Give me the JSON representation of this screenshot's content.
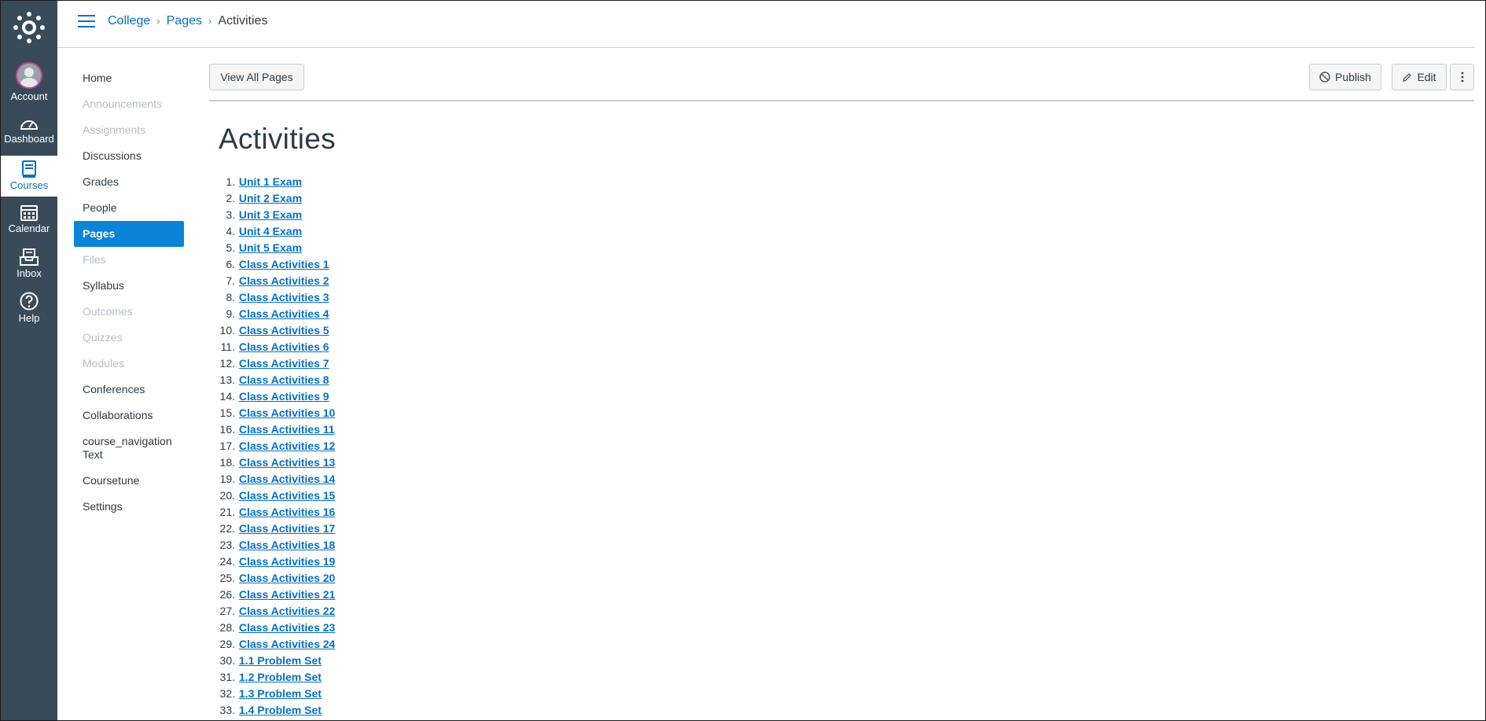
{
  "global_nav": {
    "account": "Account",
    "dashboard": "Dashboard",
    "courses": "Courses",
    "calendar": "Calendar",
    "inbox": "Inbox",
    "help": "Help"
  },
  "breadcrumb": {
    "course": "College",
    "section": "Pages",
    "current": "Activities"
  },
  "course_nav": [
    {
      "label": "Home",
      "state": "normal"
    },
    {
      "label": "Announcements",
      "state": "disabled"
    },
    {
      "label": "Assignments",
      "state": "disabled"
    },
    {
      "label": "Discussions",
      "state": "normal"
    },
    {
      "label": "Grades",
      "state": "normal"
    },
    {
      "label": "People",
      "state": "normal"
    },
    {
      "label": "Pages",
      "state": "active"
    },
    {
      "label": "Files",
      "state": "disabled"
    },
    {
      "label": "Syllabus",
      "state": "normal"
    },
    {
      "label": "Outcomes",
      "state": "disabled"
    },
    {
      "label": "Quizzes",
      "state": "disabled"
    },
    {
      "label": "Modules",
      "state": "disabled"
    },
    {
      "label": "Conferences",
      "state": "normal"
    },
    {
      "label": "Collaborations",
      "state": "normal"
    },
    {
      "label": "course_navigation Text",
      "state": "normal"
    },
    {
      "label": "Coursetune",
      "state": "normal"
    },
    {
      "label": "Settings",
      "state": "normal"
    }
  ],
  "toolbar": {
    "view_all": "View All Pages",
    "publish": "Publish",
    "edit": "Edit"
  },
  "page": {
    "title": "Activities",
    "links": [
      "Unit 1 Exam",
      "Unit 2 Exam",
      "Unit 3 Exam",
      "Unit 4 Exam",
      "Unit 5 Exam",
      "Class Activities 1",
      "Class Activities 2",
      "Class Activities 3",
      "Class Activities 4",
      "Class Activities 5",
      "Class Activities 6",
      "Class Activities 7",
      "Class Activities 8",
      "Class Activities 9",
      "Class Activities 10",
      "Class Activities 11",
      "Class Activities 12",
      "Class Activities 13",
      "Class Activities 14",
      "Class Activities 15",
      "Class Activities 16",
      "Class Activities 17",
      "Class Activities 18",
      "Class Activities 19",
      "Class Activities 20",
      "Class Activities 21",
      "Class Activities 22",
      "Class Activities 23",
      "Class Activities 24",
      "1.1 Problem Set",
      "1.2 Problem Set",
      "1.3 Problem Set",
      "1.4 Problem Set"
    ]
  },
  "colors": {
    "nav_bg": "#394b58",
    "link": "#0770c5",
    "active": "#0a84d6"
  }
}
